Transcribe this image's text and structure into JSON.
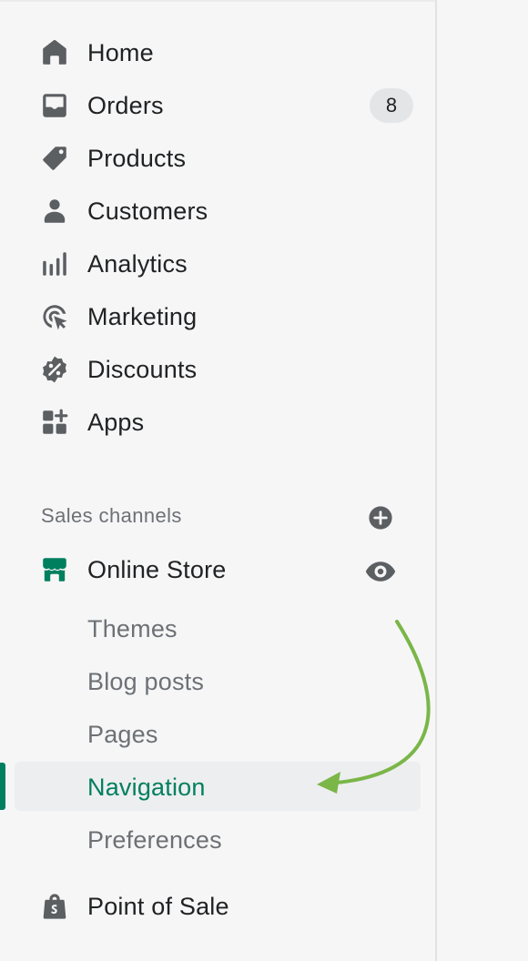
{
  "nav": {
    "items": [
      {
        "label": "Home",
        "icon": "home-icon"
      },
      {
        "label": "Orders",
        "icon": "orders-icon",
        "badge": "8"
      },
      {
        "label": "Products",
        "icon": "tag-icon"
      },
      {
        "label": "Customers",
        "icon": "person-icon"
      },
      {
        "label": "Analytics",
        "icon": "bar-chart-icon"
      },
      {
        "label": "Marketing",
        "icon": "target-icon"
      },
      {
        "label": "Discounts",
        "icon": "discount-icon"
      },
      {
        "label": "Apps",
        "icon": "apps-icon"
      }
    ]
  },
  "sales_channels": {
    "heading": "Sales channels",
    "online_store": {
      "label": "Online Store",
      "sub_items": [
        "Themes",
        "Blog posts",
        "Pages",
        "Navigation",
        "Preferences"
      ],
      "active": "Navigation"
    },
    "point_of_sale": {
      "label": "Point of Sale"
    }
  },
  "colors": {
    "accent": "#007f5f",
    "text": "#202223",
    "subdued": "#6d7175",
    "annotation_arrow": "#7ab648"
  }
}
